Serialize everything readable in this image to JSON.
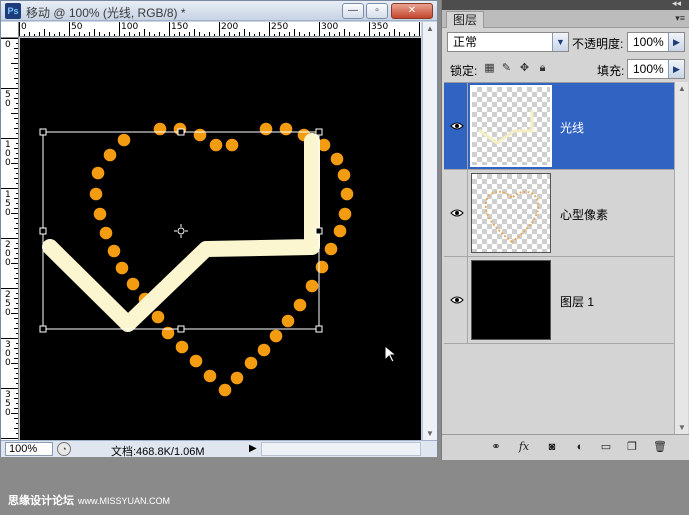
{
  "document": {
    "title": "移动 @ 100% (光线, RGB/8) *",
    "app_icon": "Ps",
    "window_buttons": {
      "minimize": "—",
      "maximize": "▫",
      "close": "✕"
    },
    "ruler_h": [
      "0",
      "50",
      "100",
      "150",
      "200",
      "250",
      "300",
      "350"
    ],
    "ruler_v": [
      "0",
      "5\n0",
      "1\n0\n0",
      "1\n5\n0",
      "2\n0\n0",
      "2\n5\n0",
      "3\n0\n0",
      "3\n5\n0"
    ],
    "zoom": "100%",
    "doc_size": "文档:468.8K/1.06M"
  },
  "panel": {
    "tab_label": "图层",
    "blend_mode": "正常",
    "opacity_label": "不透明度:",
    "opacity_value": "100%",
    "lock_label": "锁定:",
    "fill_label": "填充:",
    "fill_value": "100%",
    "layers": [
      {
        "name": "光线",
        "active": true,
        "thumb": "light-line",
        "visible": true
      },
      {
        "name": "心型像素",
        "active": false,
        "thumb": "heart",
        "visible": true
      },
      {
        "name": "图层 1",
        "active": false,
        "thumb": "black",
        "visible": true
      }
    ],
    "bottom_icons": [
      "link-icon",
      "fx-icon",
      "mask-icon",
      "adjustment-icon",
      "group-icon",
      "new-layer-icon",
      "trash-icon"
    ]
  },
  "watermark": {
    "text": "思缘设计论坛",
    "url": "www.MISSYUAN.COM"
  },
  "colors": {
    "dot": "#f39c12",
    "line": "#fbf6cf",
    "selection": "#3163c3",
    "canvas": "#000000"
  }
}
